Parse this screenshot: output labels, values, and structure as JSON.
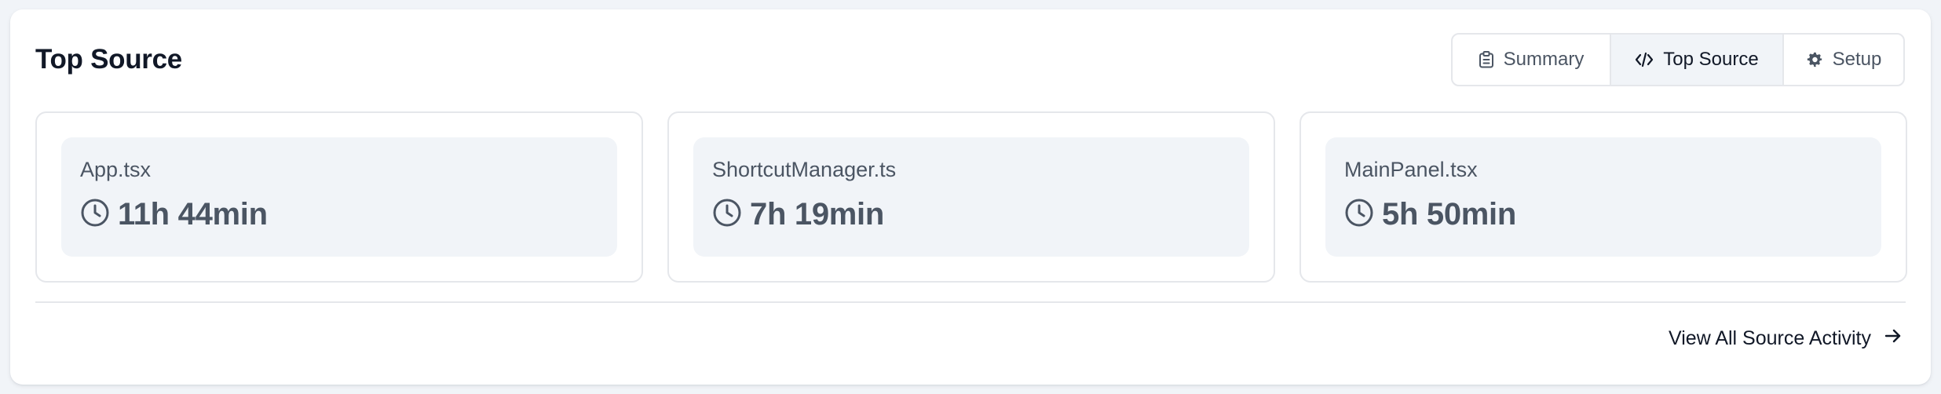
{
  "header": {
    "title": "Top Source"
  },
  "tabs": [
    {
      "label": "Summary",
      "icon": "clipboard-icon",
      "active": false
    },
    {
      "label": "Top Source",
      "icon": "code-icon",
      "active": true
    },
    {
      "label": "Setup",
      "icon": "gear-icon",
      "active": false
    }
  ],
  "sources": [
    {
      "name": "App.tsx",
      "time": "11h 44min",
      "icon": "clock-icon"
    },
    {
      "name": "ShortcutManager.ts",
      "time": "7h 19min",
      "icon": "clock-icon"
    },
    {
      "name": "MainPanel.tsx",
      "time": "5h 50min",
      "icon": "clock-icon"
    }
  ],
  "footer": {
    "link_label": "View All Source Activity",
    "link_icon": "arrow-right-icon"
  },
  "colors": {
    "page_bg": "#f1f4f8",
    "card_bg": "#ffffff",
    "inner_bg": "#f1f4f8",
    "border": "#e5e7eb",
    "text_primary": "#111827",
    "text_secondary": "#4b5563"
  }
}
